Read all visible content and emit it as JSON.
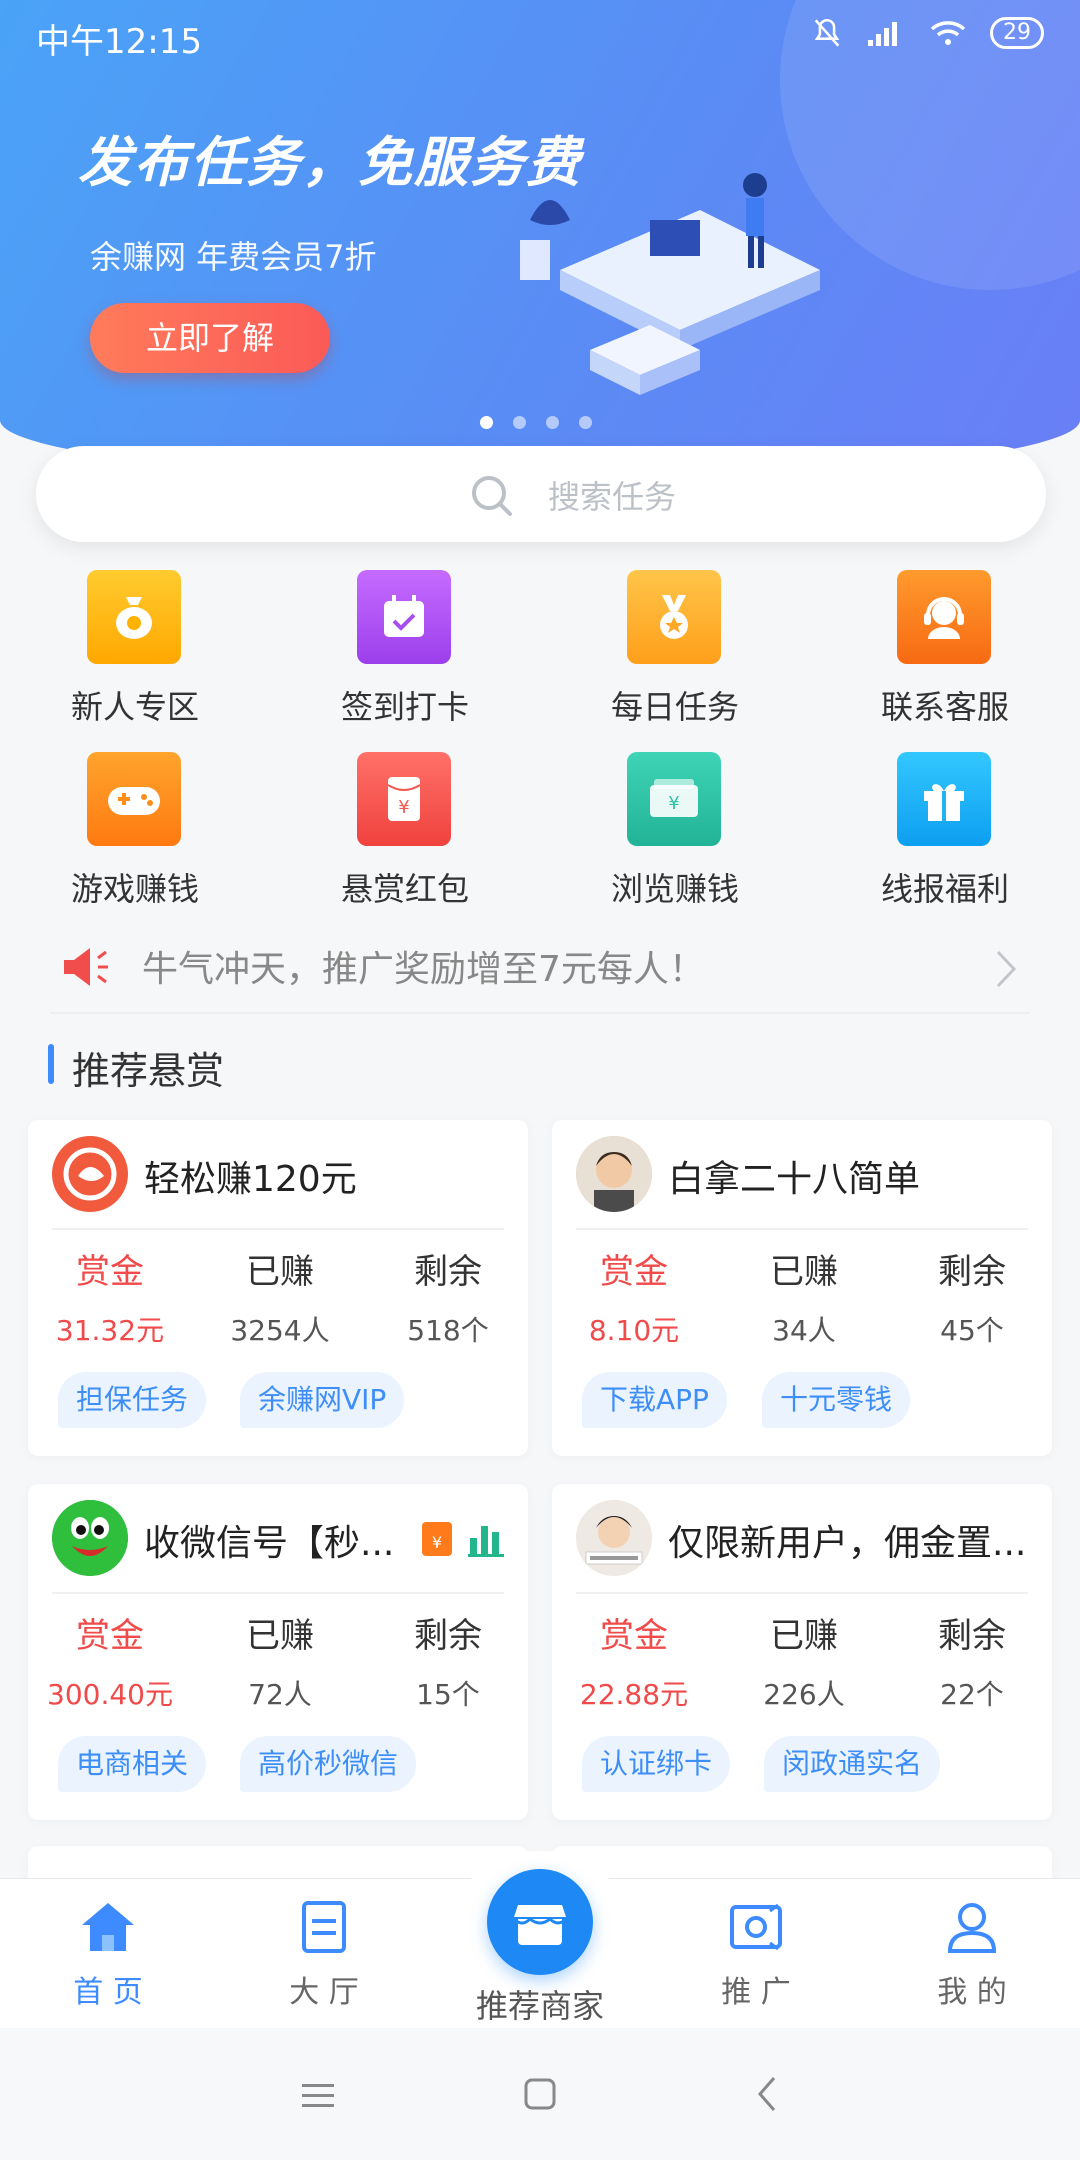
{
  "status_bar": {
    "time": "中午12:15",
    "battery": "29"
  },
  "banner": {
    "title": "发布任务，免服务费",
    "subtitle": "余赚网 年费会员7折",
    "cta": "立即了解",
    "dots": 4,
    "active_dot": 0
  },
  "search": {
    "placeholder": "搜索任务"
  },
  "grid": [
    {
      "label": "新人专区",
      "icon": "money-bag-icon",
      "color": "#ffb300"
    },
    {
      "label": "签到打卡",
      "icon": "calendar-check-icon",
      "color": "#a84ef0"
    },
    {
      "label": "每日任务",
      "icon": "medal-icon",
      "color": "#ffa726"
    },
    {
      "label": "联系客服",
      "icon": "headset-icon",
      "color": "#fb7c1e"
    },
    {
      "label": "游戏赚钱",
      "icon": "gamepad-icon",
      "color": "#ff8d1a"
    },
    {
      "label": "悬赏红包",
      "icon": "red-envelope-icon",
      "color": "#f4574f"
    },
    {
      "label": "浏览赚钱",
      "icon": "wallet-icon",
      "color": "#2fc3a3"
    },
    {
      "label": "线报福利",
      "icon": "gift-icon",
      "color": "#1fb2f5"
    }
  ],
  "notice": {
    "text": "牛气冲天，推广奖励增至7元每人！"
  },
  "section_title": "推荐悬赏",
  "cards": [
    {
      "name": "轻松赚120元",
      "reward_h": "赏金",
      "earned_h": "已赚",
      "left_h": "剩余",
      "reward": "31.32元",
      "earned": "3254人",
      "left": "518个",
      "tags": [
        "担保任务",
        "余赚网VIP"
      ]
    },
    {
      "name": "白拿二十八简单",
      "reward_h": "赏金",
      "earned_h": "已赚",
      "left_h": "剩余",
      "reward": "8.10元",
      "earned": "34人",
      "left": "45个",
      "tags": [
        "下载APP",
        "十元零钱"
      ]
    },
    {
      "name": "收微信号【秒...",
      "reward_h": "赏金",
      "earned_h": "已赚",
      "left_h": "剩余",
      "reward": "300.40元",
      "earned": "72人",
      "left": "15个",
      "tags": [
        "电商相关",
        "高价秒微信"
      ]
    },
    {
      "name": "仅限新用户，佣金置...",
      "reward_h": "赏金",
      "earned_h": "已赚",
      "left_h": "剩余",
      "reward": "22.88元",
      "earned": "226人",
      "left": "22个",
      "tags": [
        "认证绑卡",
        "闵政通实名"
      ]
    }
  ],
  "bottom_nav": [
    {
      "label": "首 页",
      "icon": "home-icon",
      "active": true
    },
    {
      "label": "大 厅",
      "icon": "document-icon",
      "active": false
    },
    {
      "label": "推荐商家",
      "icon": "shop-icon",
      "active": false
    },
    {
      "label": "推 广",
      "icon": "promote-icon",
      "active": false
    },
    {
      "label": "我 的",
      "icon": "user-icon",
      "active": false
    }
  ],
  "colors": {
    "accent": "#3d8bff",
    "reward": "#f04a4a",
    "tag_bg": "#eaf3fe",
    "tag_text": "#3e8ef7"
  }
}
